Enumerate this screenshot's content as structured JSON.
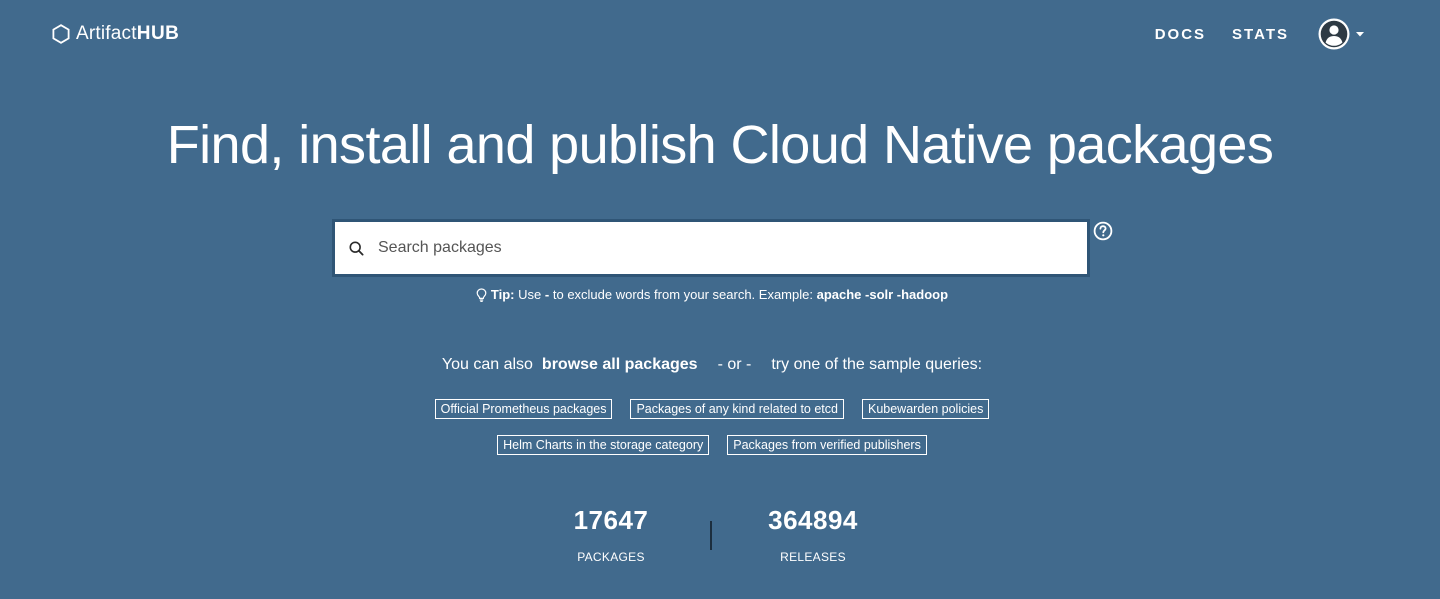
{
  "header": {
    "logo_light": "Artifact",
    "logo_bold": "HUB",
    "nav": [
      {
        "label": "DOCS"
      },
      {
        "label": "STATS"
      }
    ],
    "user_menu_icon": "user-circle-icon"
  },
  "hero": {
    "title": "Find, install and publish Cloud Native packages"
  },
  "search": {
    "placeholder": "Search packages",
    "value": ""
  },
  "tip": {
    "label": "Tip:",
    "text_before": "Use",
    "operator": "-",
    "text_after": "to exclude words from your search. Example:",
    "example": "apache -solr -hadoop"
  },
  "browse": {
    "prefix": "You can also",
    "link": "browse all packages",
    "or": "- or -",
    "suffix": "try one of the sample queries:"
  },
  "sample_queries": {
    "row1": [
      {
        "label": "Official Prometheus packages"
      },
      {
        "label": "Packages of any kind related to etcd"
      },
      {
        "label": "Kubewarden policies"
      }
    ],
    "row2": [
      {
        "label": "Helm Charts in the storage category"
      },
      {
        "label": "Packages from verified publishers"
      }
    ]
  },
  "stats": {
    "packages": {
      "value": "17647",
      "label": "PACKAGES"
    },
    "releases": {
      "value": "364894",
      "label": "RELEASES"
    }
  },
  "colors": {
    "background": "#416a8d",
    "search_border": "#2f5576",
    "text": "#ffffff"
  }
}
